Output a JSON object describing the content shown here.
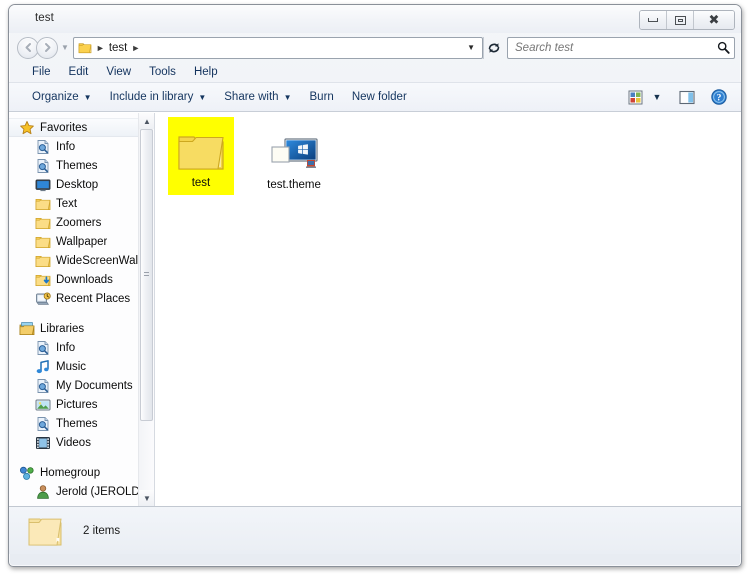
{
  "window": {
    "title": "test",
    "controls": {
      "minimize": "Minimize",
      "restore": "Restore",
      "close": "Close"
    }
  },
  "navbar": {
    "back": "Back",
    "forward": "Forward",
    "history_dropdown": "Recent pages",
    "breadcrumb": [
      "test"
    ],
    "address_dropdown": "Previous locations",
    "refresh": "Refresh",
    "search": {
      "placeholder": "Search test",
      "value": "",
      "icon": "search-icon"
    }
  },
  "menubar": {
    "items": [
      {
        "label": "File"
      },
      {
        "label": "Edit"
      },
      {
        "label": "View"
      },
      {
        "label": "Tools"
      },
      {
        "label": "Help"
      }
    ]
  },
  "toolbar": {
    "items": [
      {
        "label": "Organize",
        "has_caret": true
      },
      {
        "label": "Include in library",
        "has_caret": true
      },
      {
        "label": "Share with",
        "has_caret": true
      },
      {
        "label": "Burn",
        "has_caret": false
      },
      {
        "label": "New folder",
        "has_caret": false
      }
    ],
    "right_buttons": [
      {
        "name": "change-view-icon",
        "label": "Change your view"
      },
      {
        "name": "chevron-down-icon",
        "label": "View options"
      },
      {
        "name": "preview-pane-icon",
        "label": "Show the preview pane"
      },
      {
        "name": "help-icon",
        "label": "Get help"
      }
    ]
  },
  "navpane": {
    "groups": [
      {
        "header": {
          "label": "Favorites",
          "icon": "star-icon",
          "selected": true
        },
        "items": [
          {
            "label": "Info",
            "icon": "saved-search-icon"
          },
          {
            "label": "Themes",
            "icon": "saved-search-icon"
          },
          {
            "label": "Desktop",
            "icon": "desktop-icon"
          },
          {
            "label": "Text",
            "icon": "folder-icon"
          },
          {
            "label": "Zoomers",
            "icon": "folder-icon"
          },
          {
            "label": "Wallpaper",
            "icon": "folder-icon"
          },
          {
            "label": "WideScreenWalls",
            "icon": "folder-icon"
          },
          {
            "label": "Downloads",
            "icon": "downloads-icon"
          },
          {
            "label": "Recent Places",
            "icon": "recent-places-icon"
          }
        ]
      },
      {
        "header": {
          "label": "Libraries",
          "icon": "libraries-icon",
          "selected": false
        },
        "items": [
          {
            "label": "Info",
            "icon": "saved-search-icon"
          },
          {
            "label": "Music",
            "icon": "music-icon"
          },
          {
            "label": "My Documents",
            "icon": "saved-search-icon"
          },
          {
            "label": "Pictures",
            "icon": "pictures-icon"
          },
          {
            "label": "Themes",
            "icon": "saved-search-icon"
          },
          {
            "label": "Videos",
            "icon": "videos-icon"
          }
        ]
      },
      {
        "header": {
          "label": "Homegroup",
          "icon": "homegroup-icon",
          "selected": false
        },
        "items": [
          {
            "label": "Jerold (JEROLD-P",
            "icon": "user-icon"
          }
        ]
      }
    ],
    "scrollbar": {
      "up": "Scroll up",
      "down": "Scroll down",
      "thumb": "Scroll thumb"
    }
  },
  "content": {
    "items": [
      {
        "label": "test",
        "icon": "folder-icon",
        "selected": true,
        "highlight_color": "#ffff00"
      },
      {
        "label": "test.theme",
        "icon": "theme-file-icon",
        "selected": false
      }
    ]
  },
  "statusbar": {
    "icon": "folder-icon",
    "text": "2 items"
  },
  "colors": {
    "selection_highlight": "#ffff00",
    "folder_yellow": "#fcd975",
    "link_blue": "#14355f"
  }
}
